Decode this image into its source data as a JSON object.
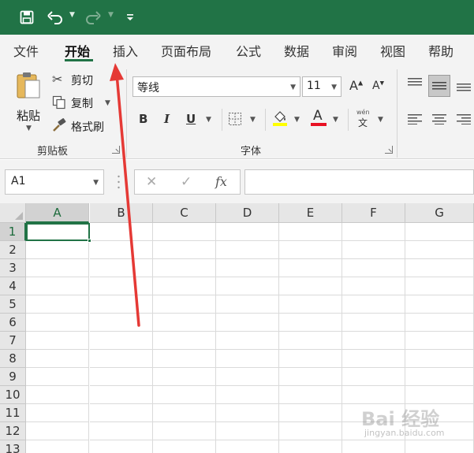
{
  "quick_access": {
    "save_icon": "save-icon",
    "undo_icon": "undo-icon",
    "redo_icon": "redo-icon",
    "customize_icon": "customize-icon"
  },
  "tabs": [
    {
      "label": "文件"
    },
    {
      "label": "开始",
      "active": true
    },
    {
      "label": "插入"
    },
    {
      "label": "页面布局"
    },
    {
      "label": "公式"
    },
    {
      "label": "数据"
    },
    {
      "label": "审阅"
    },
    {
      "label": "视图"
    },
    {
      "label": "帮助"
    }
  ],
  "clipboard": {
    "paste_label": "粘贴",
    "cut_label": "剪切",
    "copy_label": "复制",
    "format_painter_label": "格式刷",
    "group_label": "剪贴板"
  },
  "font": {
    "font_name": "等线",
    "font_size": "11",
    "bold_label": "B",
    "italic_label": "I",
    "underline_label": "U",
    "font_color_label": "A",
    "phonetic_top": "wén",
    "phonetic_bottom": "文",
    "group_label": "字体",
    "fill_color": "#ffff00",
    "text_color": "#e81123"
  },
  "formula_bar": {
    "name_box": "A1",
    "fx_label": "fx",
    "cancel_symbol": "✕",
    "enter_symbol": "✓"
  },
  "sheet": {
    "columns": [
      "A",
      "B",
      "C",
      "D",
      "E",
      "F",
      "G"
    ],
    "rows": [
      "1",
      "2",
      "3",
      "4",
      "5",
      "6",
      "7",
      "8",
      "9",
      "10",
      "11",
      "12",
      "13"
    ],
    "selected_cell": "A1"
  },
  "watermark": {
    "main": "Bai 经验",
    "sub": "jingyan.baidu.com"
  },
  "colors": {
    "accent": "#217346",
    "annotation_arrow": "#e53935"
  }
}
